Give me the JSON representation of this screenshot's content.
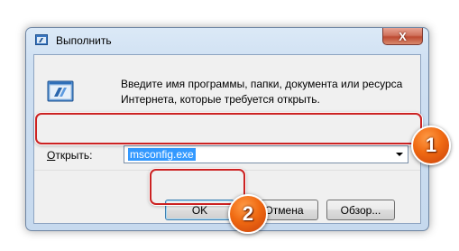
{
  "window": {
    "title": "Выполнить",
    "close_glyph": "X"
  },
  "description": {
    "line1": "Введите имя программы, папки, документа или ресурса",
    "line2": "Интернета, которые требуется открыть."
  },
  "open_field": {
    "label_underlined": "О",
    "label_rest": "ткрыть:",
    "value": "msconfig.exe"
  },
  "buttons": {
    "ok": "OK",
    "cancel": "Отмена",
    "browse": "Обзор..."
  },
  "annotations": {
    "badge1": "1",
    "badge2": "2",
    "highlight_color": "#cc2222",
    "badge_color": "#f06a12"
  },
  "icons": {
    "title": "run-icon",
    "big": "run-program-icon",
    "combo_arrow": "chevron-down-icon"
  }
}
